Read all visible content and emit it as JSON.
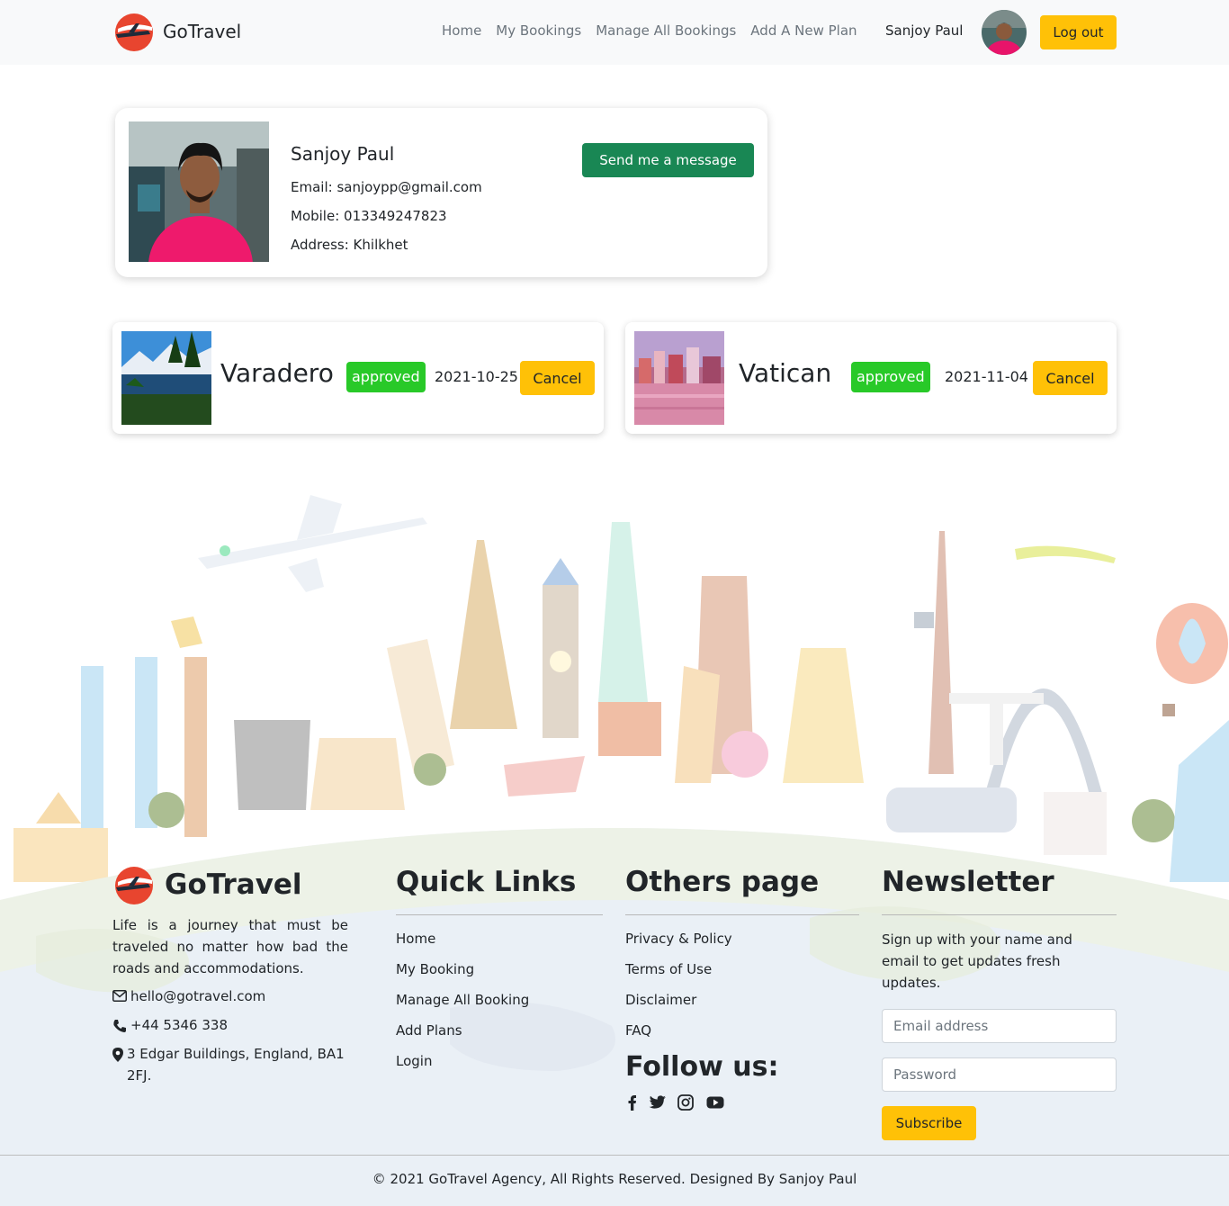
{
  "navbar": {
    "brand": "GoTravel",
    "links": [
      "Home",
      "My Bookings",
      "Manage All Bookings",
      "Add A New Plan"
    ],
    "user_name": "Sanjoy Paul",
    "logout_label": "Log out"
  },
  "profile": {
    "name": "Sanjoy Paul",
    "email": "Email: sanjoypp@gmail.com",
    "mobile": "Mobile: 013349247823",
    "address": "Address: Khilkhet",
    "message_button": "Send me a message"
  },
  "bookings": [
    {
      "place": "Varadero",
      "status": "approved",
      "date": "2021-10-25",
      "cancel_label": "Cancel"
    },
    {
      "place": "Vatican",
      "status": "approved",
      "date": "2021-11-04",
      "cancel_label": "Cancel"
    }
  ],
  "footer": {
    "brand": "GoTravel",
    "about": "Life is a journey that must be traveled no matter how bad the roads and accommodations.",
    "email": "hello@gotravel.com",
    "phone": "+44 5346 338",
    "address": "3 Edgar Buildings, England, BA1 2FJ.",
    "quick_links": {
      "title": "Quick Links",
      "items": [
        "Home",
        "My Booking",
        "Manage All Booking",
        "Add Plans",
        "Login"
      ]
    },
    "others": {
      "title": "Others page",
      "items": [
        "Privacy & Policy",
        "Terms of Use",
        "Disclaimer",
        "FAQ"
      ]
    },
    "follow_title": "Follow us:",
    "social_icons": [
      "facebook-icon",
      "twitter-icon",
      "instagram-icon",
      "youtube-icon"
    ],
    "newsletter": {
      "title": "Newsletter",
      "text": "Sign up with your name and email to get updates fresh updates.",
      "email_placeholder": "Email address",
      "password_placeholder": "Password",
      "subscribe_label": "Subscribe"
    },
    "copyright": "© 2021 GoTravel Agency, All Rights Reserved. Designed By Sanjoy Paul"
  },
  "colors": {
    "accent_yellow": "#ffc107",
    "message_green": "#198754",
    "badge_green": "#28c928",
    "navbar_bg": "#f8f9fa"
  }
}
